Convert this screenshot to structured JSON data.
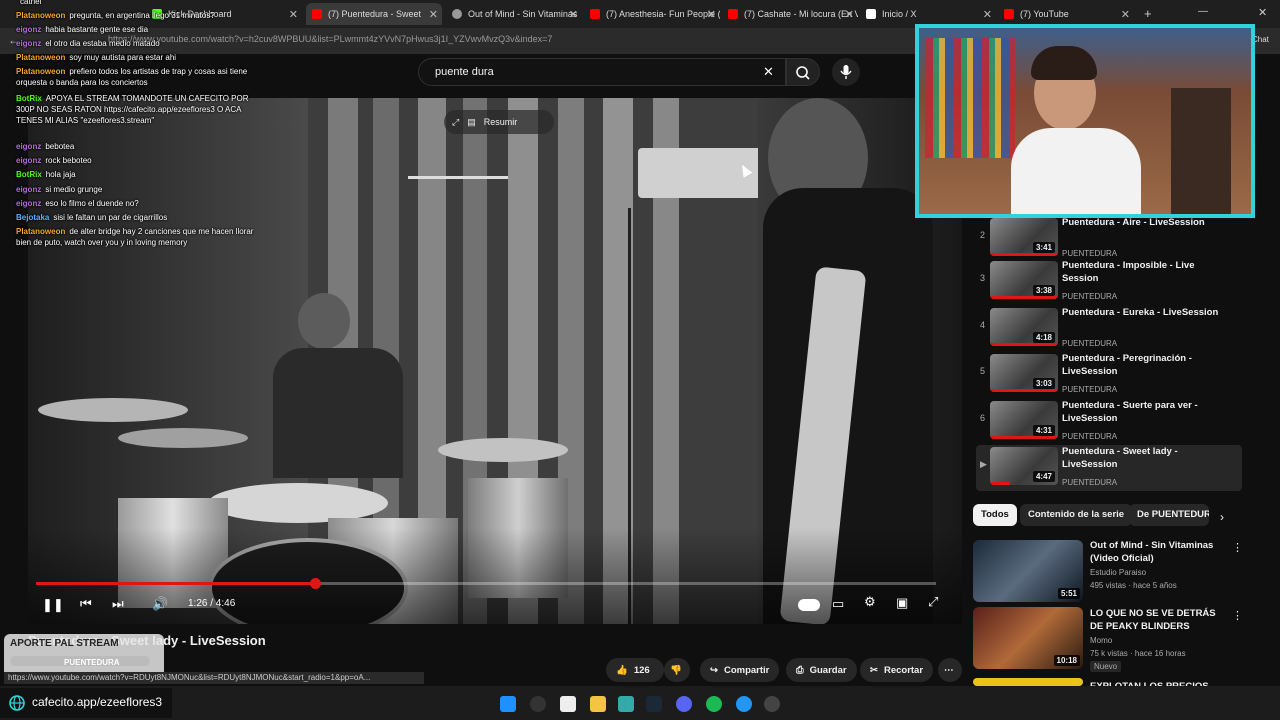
{
  "browser": {
    "tabs": [
      {
        "label": "Kick Dashboard"
      },
      {
        "label": "(7) Puentedura - Sweet"
      },
      {
        "label": "Out of Mind - Sin Vitaminas"
      },
      {
        "label": "(7) Anesthesia- Fun People ("
      },
      {
        "label": "(7) Cashate - Mi locura (En V"
      },
      {
        "label": "Inicio / X"
      },
      {
        "label": "(7) YouTube"
      }
    ],
    "url": "https://www.youtube.com/watch?v=h2cuv8WPBUU&list=PLwmmt4zYVvN7pHwus3j1I_YZVwvMvzQ3v&index=7",
    "chat_button": "Chat"
  },
  "search": {
    "value": "puente dura"
  },
  "video": {
    "overlay_summarize": "Resumir",
    "time": "1:26 / 4:46",
    "progress": 0.31,
    "title": "Puentedura - Sweet lady - LiveSession",
    "channel": "PUENTEDURA"
  },
  "chat": [
    {
      "user": "",
      "msg": "catriel"
    },
    {
      "user": "Platanoweon",
      "msg": "pregunta, en argentina llego 31 minutos?"
    },
    {
      "user": "eigonz",
      "msg": "habia bastante gente ese dia"
    },
    {
      "user": "eigonz",
      "msg": "el otro dia estaba medio matado"
    },
    {
      "user": "Platanoweon",
      "msg": "soy muy autista para estar ahi"
    },
    {
      "user": "Platanoweon",
      "msg": "prefiero todos los artistas de trap y cosas asi tiene orquesta o banda para los conciertos"
    },
    {
      "user": "BotRix",
      "msg": "APOYA EL STREAM TOMANDOTE UN CAFECITO POR 300P NO SEAS RATON https://cafecito.app/ezeeflores3 O ACA TENES MI ALIAS \"ezeeflores3.stream\""
    },
    {
      "user": "eigonz",
      "msg": "bebotea"
    },
    {
      "user": "eigonz",
      "msg": "rock beboteo"
    },
    {
      "user": "BotRix",
      "msg": "hola jaja"
    },
    {
      "user": "eigonz",
      "msg": "si medio grunge"
    },
    {
      "user": "eigonz",
      "msg": "eso lo filmo el duende no?"
    },
    {
      "user": "Bejotaka",
      "msg": "sisi le faltan un par de cigarrillos"
    },
    {
      "user": "Platanoweon",
      "msg": "de alter bridge hay 2 canciones que me hacen llorar bien de puto, watch over you y in loving memory"
    }
  ],
  "playlist": [
    {
      "num": "2",
      "title": "Puentedura - Aire - LiveSession",
      "channel": "PUENTEDURA",
      "duration": "3:41"
    },
    {
      "num": "3",
      "title": "Puentedura - Imposible - Live Session",
      "channel": "PUENTEDURA",
      "duration": "3:38"
    },
    {
      "num": "4",
      "title": "Puentedura - Eureka - LiveSession",
      "channel": "PUENTEDURA",
      "duration": "4:18"
    },
    {
      "num": "5",
      "title": "Puentedura - Peregrinación - LiveSession",
      "channel": "PUENTEDURA",
      "duration": "3:03"
    },
    {
      "num": "6",
      "title": "Puentedura - Suerte para ver - LiveSession",
      "channel": "PUENTEDURA",
      "duration": "4:31"
    },
    {
      "num": "▶",
      "title": "Puentedura - Sweet lady - LiveSession",
      "channel": "PUENTEDURA",
      "duration": "4:47"
    }
  ],
  "chips": [
    "Todos",
    "Contenido de la serie",
    "De PUENTEDUR"
  ],
  "recs": [
    {
      "title": "Out of Mind - Sin Vitaminas (Video Oficial)",
      "channel": "Estudio Paraiso",
      "meta": "495 vistas · hace 5 años",
      "duration": "5:51"
    },
    {
      "title": "LO QUE NO SE VE DETRÁS DE PEAKY BLINDERS",
      "channel": "Momo",
      "meta": "75 k vistas · hace 16 horas",
      "badge": "Nuevo",
      "duration": "10:18"
    },
    {
      "title": "EXPLOTAN LOS PRECIOS",
      "channel": "",
      "meta": "",
      "duration": ""
    }
  ],
  "actions": {
    "likes": "126",
    "share": "Compartir",
    "save": "Guardar",
    "clip": "Recortar"
  },
  "overlay": {
    "donation_title": "APORTE PAL STREAM",
    "status_link": "https://www.youtube.com/watch?v=RDUyt8NJMONuc&list=RDUyt8NJMONuc&start_radio=1&pp=oA...",
    "cafecito": "cafecito.app/ezeeflores3"
  },
  "colors": {
    "accent": "#e21515",
    "webcam_border": "#2fd3d9",
    "cafecito": "#2fd3d9"
  }
}
